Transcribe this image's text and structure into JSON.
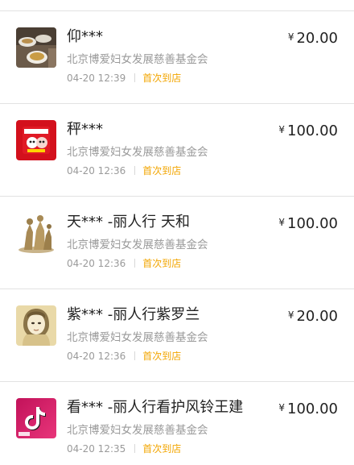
{
  "donations": [
    {
      "donor": "仰***",
      "organization": "北京博爱妇女发展慈善基金会",
      "time": "04-20 12:39",
      "tag": "首次到店",
      "currency": "¥",
      "amount": "20.00",
      "avatar_icon": "tea-photo-avatar"
    },
    {
      "donor": "秤***",
      "organization": "北京博爱妇女发展慈善基金会",
      "time": "04-20 12:36",
      "tag": "首次到店",
      "currency": "¥",
      "amount": "100.00",
      "avatar_icon": "red-cartoon-avatar"
    },
    {
      "donor": "天*** -丽人行 天和",
      "organization": "北京博爱妇女发展慈善基金会",
      "time": "04-20 12:36",
      "tag": "首次到店",
      "currency": "¥",
      "amount": "100.00",
      "avatar_icon": "statue-avatar"
    },
    {
      "donor": "紫*** -丽人行紫罗兰",
      "organization": "北京博爱妇女发展慈善基金会",
      "time": "04-20 12:36",
      "tag": "首次到店",
      "currency": "¥",
      "amount": "20.00",
      "avatar_icon": "sketch-portrait-avatar"
    },
    {
      "donor": "看*** -丽人行看护风铃王建",
      "organization": "北京博爱妇女发展慈善基金会",
      "time": "04-20 12:35",
      "tag": "首次到店",
      "currency": "¥",
      "amount": "100.00",
      "avatar_icon": "tiktok-logo-avatar"
    }
  ],
  "colors": {
    "tag": "#f2a500",
    "name": "#222222",
    "secondary": "#9a9a9a",
    "divider": "#e2e2e2"
  }
}
